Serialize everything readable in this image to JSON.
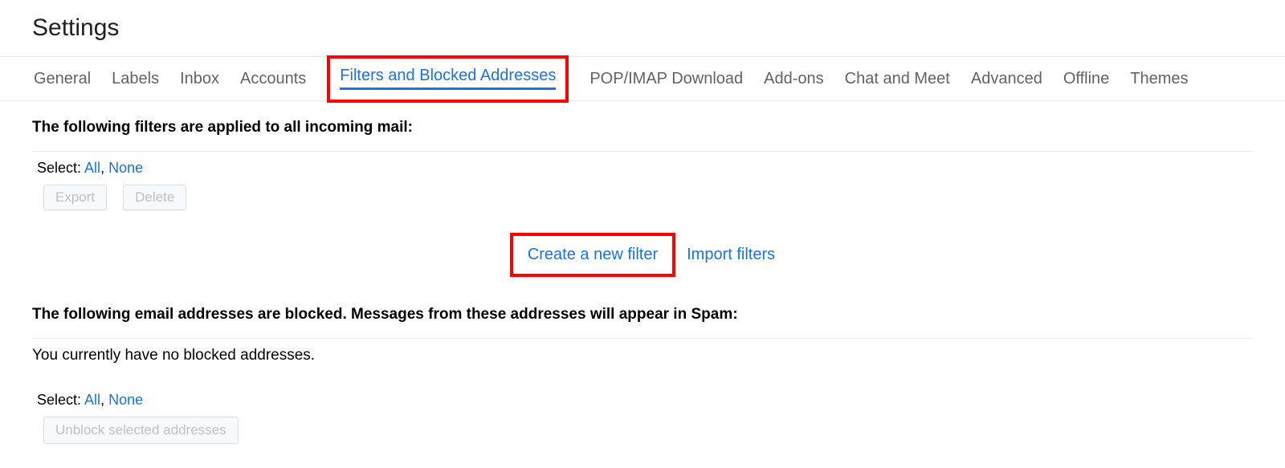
{
  "header": {
    "title": "Settings"
  },
  "tabs": {
    "general": "General",
    "labels": "Labels",
    "inbox": "Inbox",
    "accounts": "Accounts",
    "filters": "Filters and Blocked Addresses",
    "popimap": "POP/IMAP Download",
    "addons": "Add-ons",
    "chatmeet": "Chat and Meet",
    "advanced": "Advanced",
    "offline": "Offline",
    "themes": "Themes"
  },
  "filters_section": {
    "heading": "The following filters are applied to all incoming mail:",
    "select_label": "Select:",
    "select_all": "All",
    "select_sep": ", ",
    "select_none": "None",
    "export_btn": "Export",
    "delete_btn": "Delete",
    "create_link": "Create a new filter",
    "import_link": "Import filters"
  },
  "blocked_section": {
    "heading": "The following email addresses are blocked. Messages from these addresses will appear in Spam:",
    "empty_msg": "You currently have no blocked addresses.",
    "select_label": "Select:",
    "select_all": "All",
    "select_sep": ", ",
    "select_none": "None",
    "unblock_btn": "Unblock selected addresses"
  }
}
